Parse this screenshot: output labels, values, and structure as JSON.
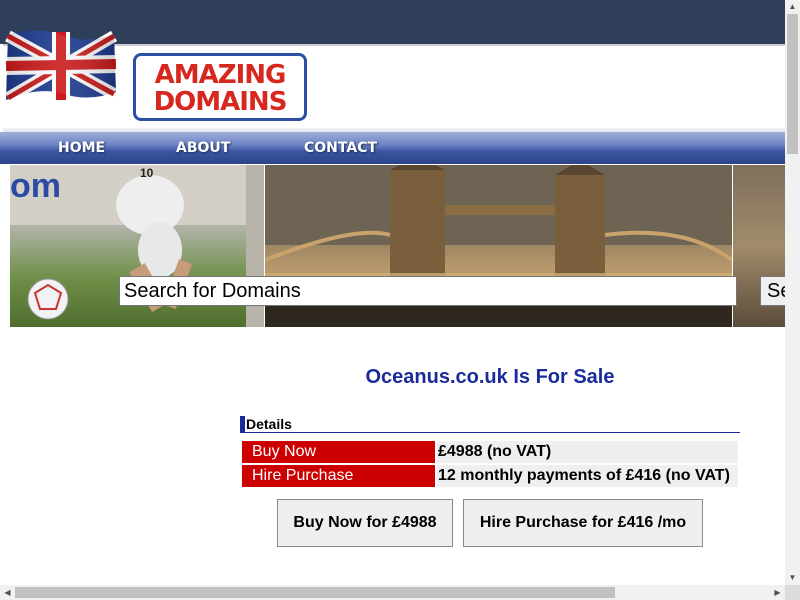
{
  "logo": {
    "line1": "AMAZING",
    "line2": "DOMAINS"
  },
  "nav": {
    "home": "HOME",
    "about": "ABOUT",
    "contact": "CONTACT"
  },
  "search": {
    "value": "Search for Domains",
    "button_label": "Search"
  },
  "title": "Oceanus.co.uk Is For Sale",
  "details": {
    "header": "Details",
    "rows": [
      {
        "label": "Buy Now",
        "value": "£4988 (no VAT)"
      },
      {
        "label": "Hire Purchase",
        "value": "12 monthly payments of £416 (no VAT)"
      }
    ]
  },
  "actions": {
    "buy_now": "Buy Now for £4988",
    "hire_purchase": "Hire Purchase for £416 /mo"
  },
  "colors": {
    "top_band": "#2f3e59",
    "nav_blue": "#3c56a3",
    "accent_red": "#cc0000",
    "title_blue": "#1a2c9c"
  },
  "icons": {
    "flag": "union-jack-flag-icon",
    "scroll_up": "triangle-up-icon",
    "scroll_down": "triangle-down-icon",
    "scroll_left": "triangle-left-icon",
    "scroll_right": "triangle-right-icon"
  }
}
